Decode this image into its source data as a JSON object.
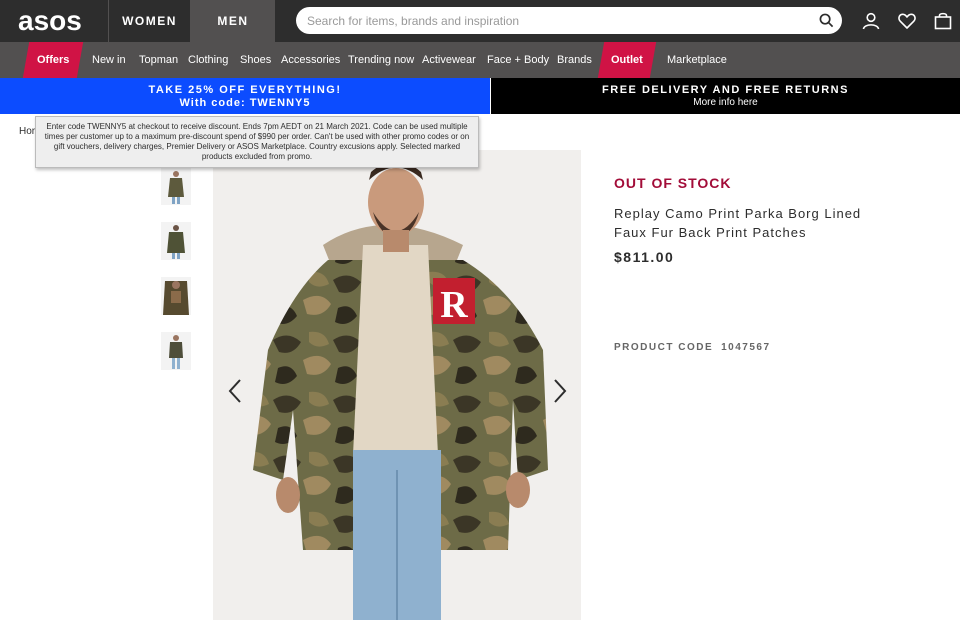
{
  "header": {
    "logo_text": "asos",
    "nav_women": "WOMEN",
    "nav_men": "MEN",
    "search_placeholder": "Search for items, brands and inspiration",
    "icons": [
      "search-icon",
      "account-icon",
      "heart-icon",
      "bag-icon"
    ]
  },
  "nav": {
    "items": [
      "Offers",
      "New in",
      "Topman",
      "Clothing",
      "Shoes",
      "Accessories",
      "Trending now",
      "Activewear",
      "Face + Body",
      "Brands",
      "Outlet",
      "Marketplace"
    ]
  },
  "promo": {
    "left_line1": "TAKE 25% OFF EVERYTHING!",
    "left_line2": "With code: TWENNY5",
    "right_line1": "FREE DELIVERY AND FREE RETURNS",
    "right_line2": "More info here"
  },
  "tooltip": {
    "text": "Enter code TWENNY5 at checkout to receive discount. Ends 7pm AEDT on 21 March 2021. Code can be used multiple times per customer up to a maximum pre-discount spend of $990 per order. Can't be used with other promo codes or on gift vouchers, delivery charges, Premier Delivery or ASOS Marketplace. Country excusions apply. Selected marked products excluded from promo."
  },
  "breadcrumb": "Hor",
  "product": {
    "stock_status": "OUT OF STOCK",
    "title": "Replay Camo Print Parka Borg Lined Faux Fur Back Print Patches",
    "price": "$811.00",
    "code_label": "PRODUCT CODE",
    "code_value": "1047567",
    "patch_letter": "R"
  },
  "colors": {
    "topbar": "#2d2d2d",
    "navbar": "#525050",
    "accent_red": "#d01345",
    "promo_blue": "#0c4cff",
    "stock_red": "#a20c38"
  }
}
